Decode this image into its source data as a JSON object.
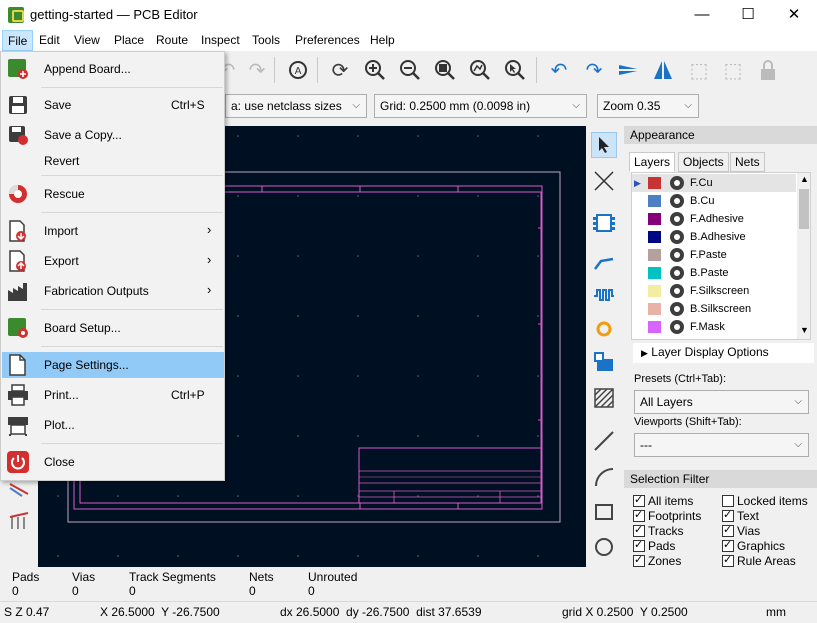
{
  "window": {
    "title": "getting-started — PCB Editor",
    "minimize": "—",
    "maximize": "☐",
    "close": "✕"
  },
  "menubar": [
    "File",
    "Edit",
    "View",
    "Place",
    "Route",
    "Inspect",
    "Tools",
    "Preferences",
    "Help"
  ],
  "toolbar2": {
    "via_combo": "a: use netclass sizes",
    "grid_combo": "Grid: 0.2500 mm (0.0098 in)",
    "zoom_combo": "Zoom 0.35"
  },
  "file_menu": {
    "items": [
      {
        "label": "Append Board...",
        "shortcut": "",
        "submenu": false,
        "icon": "append-board-icon"
      },
      {
        "label": "Save",
        "shortcut": "Ctrl+S",
        "submenu": false,
        "icon": "save-icon"
      },
      {
        "label": "Save a Copy...",
        "shortcut": "",
        "submenu": false,
        "icon": "save-copy-icon"
      },
      {
        "label": "Revert",
        "shortcut": "",
        "submenu": false,
        "icon": ""
      },
      {
        "label": "Rescue",
        "shortcut": "",
        "submenu": false,
        "icon": "rescue-icon"
      },
      {
        "label": "Import",
        "shortcut": "",
        "submenu": true,
        "icon": "import-icon"
      },
      {
        "label": "Export",
        "shortcut": "",
        "submenu": true,
        "icon": "export-icon"
      },
      {
        "label": "Fabrication Outputs",
        "shortcut": "",
        "submenu": true,
        "icon": "fabrication-icon"
      },
      {
        "label": "Board Setup...",
        "shortcut": "",
        "submenu": false,
        "icon": "board-setup-icon"
      },
      {
        "label": "Page Settings...",
        "shortcut": "",
        "submenu": false,
        "icon": "page-settings-icon"
      },
      {
        "label": "Print...",
        "shortcut": "Ctrl+P",
        "submenu": false,
        "icon": "print-icon"
      },
      {
        "label": "Plot...",
        "shortcut": "",
        "submenu": false,
        "icon": "plot-icon"
      },
      {
        "label": "Close",
        "shortcut": "",
        "submenu": false,
        "icon": "close-power-icon"
      }
    ],
    "highlighted": "Page Settings...",
    "submenu_arrow": "›"
  },
  "appearance": {
    "header": "Appearance",
    "tabs": [
      "Layers",
      "Objects",
      "Nets"
    ],
    "active_tab": "Layers",
    "layers": [
      {
        "name": "F.Cu",
        "color": "#c83434"
      },
      {
        "name": "B.Cu",
        "color": "#4d7fc4"
      },
      {
        "name": "F.Adhesive",
        "color": "#84007b"
      },
      {
        "name": "B.Adhesive",
        "color": "#000784"
      },
      {
        "name": "F.Paste",
        "color": "#b4a09c"
      },
      {
        "name": "B.Paste",
        "color": "#00c2c2"
      },
      {
        "name": "F.Silkscreen",
        "color": "#f2eda1"
      },
      {
        "name": "B.Silkscreen",
        "color": "#e8b2a7"
      },
      {
        "name": "F.Mask",
        "color": "#d864ff"
      }
    ],
    "active_layer": "F.Cu",
    "layer_display_options": "Layer Display Options",
    "presets_label": "Presets (Ctrl+Tab):",
    "presets_value": "All Layers",
    "viewports_label": "Viewports (Shift+Tab):",
    "viewports_value": "---"
  },
  "selection_filter": {
    "header": "Selection Filter",
    "items": [
      {
        "label": "All items",
        "checked": true
      },
      {
        "label": "Locked items",
        "checked": false
      },
      {
        "label": "Footprints",
        "checked": true
      },
      {
        "label": "Text",
        "checked": true
      },
      {
        "label": "Tracks",
        "checked": true
      },
      {
        "label": "Vias",
        "checked": true
      },
      {
        "label": "Pads",
        "checked": true
      },
      {
        "label": "Graphics",
        "checked": true
      },
      {
        "label": "Zones",
        "checked": true
      },
      {
        "label": "Rule Areas",
        "checked": true
      }
    ]
  },
  "status_counts": [
    {
      "label": "Pads",
      "value": "0"
    },
    {
      "label": "Vias",
      "value": "0"
    },
    {
      "label": "Track Segments",
      "value": "0"
    },
    {
      "label": "Nets",
      "value": "0"
    },
    {
      "label": "Unrouted",
      "value": "0"
    }
  ],
  "status_bar": {
    "zoom": "S Z 0.47",
    "cursor": "X 26.5000  Y -26.7500",
    "delta": "dx 26.5000  dy -26.7500  dist 37.6539",
    "grid": "grid X 0.2500  Y 0.2500",
    "units": "mm"
  },
  "colors": {
    "canvas_bg": "#001023",
    "sheet_border": "#c4a3c4",
    "frame_lines": "#d85cc8",
    "menu_highlight": "#91c9f7",
    "tool_blue": "#1a73c7"
  }
}
